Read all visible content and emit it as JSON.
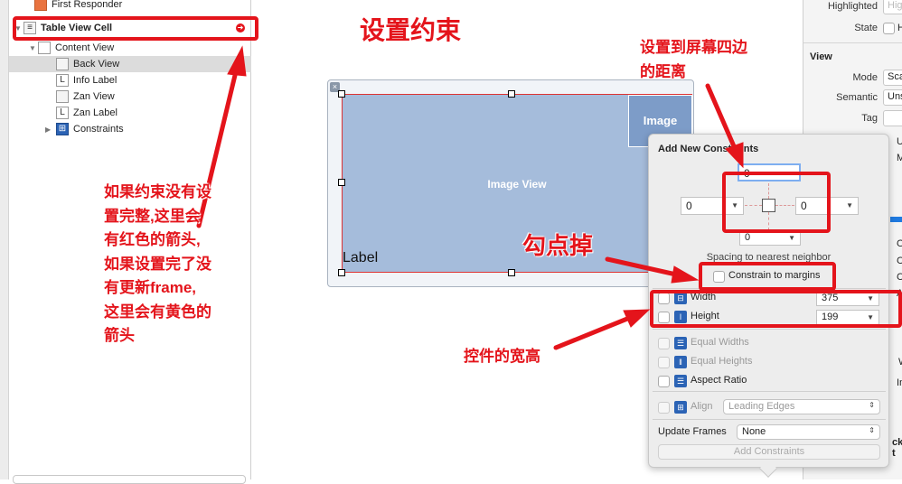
{
  "outline": {
    "items": [
      {
        "label": "First Responder",
        "icon": "first-responder-icon"
      },
      {
        "label": "Table View Cell",
        "icon": "table-cell-icon",
        "status": "error-indicator"
      },
      {
        "label": "Content View",
        "icon": "view-icon"
      },
      {
        "label": "Back View",
        "icon": "image-view-icon",
        "selected": true
      },
      {
        "label": "Info Label",
        "icon": "label-icon",
        "glyph": "L"
      },
      {
        "label": "Zan View",
        "icon": "image-view-icon"
      },
      {
        "label": "Zan Label",
        "icon": "label-icon",
        "glyph": "L"
      },
      {
        "label": "Constraints",
        "icon": "constraints-icon"
      }
    ]
  },
  "canvas": {
    "image_view_label": "Image View",
    "image_small_label": "Image",
    "image_small_sub": "O",
    "label_text": "Label"
  },
  "annotations": {
    "title": "设置约束",
    "edges_line1": "设置到屏幕四边",
    "edges_line2": "的距离",
    "uncheck": "勾点掉",
    "size": "控件的宽高",
    "note_lines": [
      "如果约束没有设",
      "置完整,这里会",
      "有红色的箭头,",
      "如果设置完了没",
      "有更新frame,",
      "这里会有黄色的",
      "箭头"
    ],
    "color": "#e4141b"
  },
  "popover": {
    "title": "Add New Constraints",
    "top": "0",
    "left": "0",
    "right": "0",
    "bottom": "0",
    "spacing_label": "Spacing to nearest neighbor",
    "constrain_margins": "Constrain to margins",
    "width_label": "Width",
    "width_value": "375",
    "height_label": "Height",
    "height_value": "199",
    "equal_widths": "Equal Widths",
    "equal_heights": "Equal Heights",
    "aspect_ratio": "Aspect Ratio",
    "align_label": "Align",
    "align_value": "Leading Edges",
    "update_frames_label": "Update Frames",
    "update_frames_value": "None",
    "add_button": "Add Constraints"
  },
  "inspector": {
    "highlighted_label": "Highlighted",
    "highlighted_placeholder": "Highlighted",
    "state_label": "State",
    "state_option": "H",
    "section": "View",
    "mode_label": "Mode",
    "mode_value": "Scale",
    "semantic_label": "Semantic",
    "semantic_value": "Unspecified",
    "tag_label": "Tag",
    "partial": [
      "U",
      "M",
      "O",
      "C",
      "C",
      "A",
      "W",
      "In",
      "ck t"
    ]
  }
}
